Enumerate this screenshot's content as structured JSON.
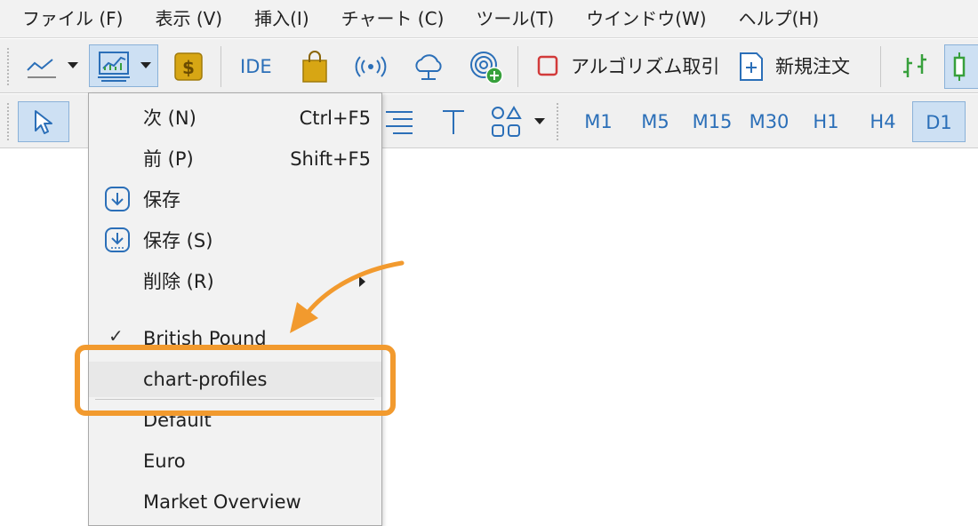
{
  "menubar": {
    "items": [
      "ファイル (F)",
      "表示 (V)",
      "挿入(I)",
      "チャート (C)",
      "ツール(T)",
      "ウインドウ(W)",
      "ヘルプ(H)"
    ]
  },
  "toolbar1": {
    "ide_label": "IDE",
    "algo_label": "アルゴリズム取引",
    "new_order_label": "新規注文"
  },
  "toolbar2": {
    "timeframes": [
      "M1",
      "M5",
      "M15",
      "M30",
      "H1",
      "H4",
      "D1"
    ],
    "active_timeframe": "D1"
  },
  "dropdown": {
    "items": [
      {
        "label": "次 (N)",
        "shortcut": "Ctrl+F5"
      },
      {
        "label": "前 (P)",
        "shortcut": "Shift+F5"
      },
      {
        "label": "保存",
        "icon": "save-icon"
      },
      {
        "label": "保存 (S)",
        "icon": "save-icon"
      },
      {
        "label": "削除 (R)",
        "submenu": true
      }
    ],
    "profiles": [
      {
        "label": "British Pound",
        "checked": true,
        "check_glyph": "✓"
      },
      {
        "label": "chart-profiles"
      },
      {
        "label": "Default"
      },
      {
        "label": "Euro"
      },
      {
        "label": "Market Overview"
      }
    ]
  },
  "annotation": {
    "color": "#f29a2e",
    "highlighted_item": "chart-profiles"
  }
}
